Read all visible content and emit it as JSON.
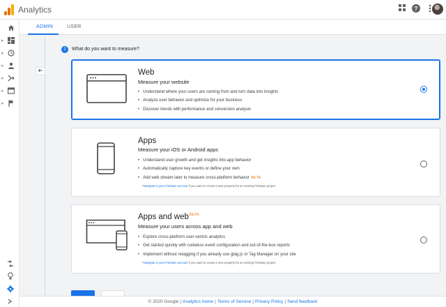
{
  "app": {
    "title": "Analytics",
    "logo_colors": [
      "#f9ab00",
      "#e37400",
      "#e37400"
    ]
  },
  "topbar_icons": [
    "apps-grid-icon",
    "help-icon",
    "more-vert-icon",
    "account-avatar"
  ],
  "rail": {
    "items": [
      "home-icon",
      "customization-icon",
      "realtime-icon",
      "audience-icon",
      "acquisition-icon",
      "behavior-icon",
      "conversions-icon"
    ],
    "bottom": [
      "attribution-icon",
      "discover-icon",
      "admin-icon",
      "expand-icon"
    ]
  },
  "tabs": [
    {
      "label": "ADMIN",
      "active": true
    },
    {
      "label": "USER",
      "active": false
    }
  ],
  "step": {
    "number": "2",
    "title": "What do you want to measure?"
  },
  "options": [
    {
      "title": "Web",
      "beta": "",
      "subtitle": "Measure your website",
      "bullets": [
        "Understand where your users are coming from and turn data into insights",
        "Analyze user behavior and optimize for your business",
        "Discover trends with performance and conversion analysis"
      ],
      "bullet_beta": "",
      "note_link": "",
      "note_text": "",
      "selected": true
    },
    {
      "title": "Apps",
      "beta": "",
      "subtitle": "Measure your iOS or Android apps",
      "bullets": [
        "Understand user growth and get insights into app behavior",
        "Automatically capture key events or define your own",
        "Add web stream later to measure cross-platform behavior"
      ],
      "bullet_beta": "BETA",
      "note_link": "*Navigate to your Firebase account",
      "note_text": " if you want to create a new property for an existing Firebase project",
      "selected": false
    },
    {
      "title": "Apps and web",
      "beta": "BETA",
      "subtitle": "Measure your users across app and web",
      "bullets": [
        "Explore cross-platform user-centric analytics",
        "Get started quickly with codeless event configuration and out-of-the-box reports",
        "Implement without retagging if you already use gtag.js or Tag Manager on your site"
      ],
      "bullet_beta": "",
      "note_link": "*Navigate to your Firebase account",
      "note_text": " if you want to create a new property for an existing Firebase project",
      "selected": false
    }
  ],
  "footer": {
    "copyright": "© 2020 Google",
    "links": [
      "Analytics home",
      "Terms of Service",
      "Privacy Policy",
      "Send feedback"
    ]
  },
  "colors": {
    "accent": "#1a73e8",
    "beta": "#e8710a"
  }
}
